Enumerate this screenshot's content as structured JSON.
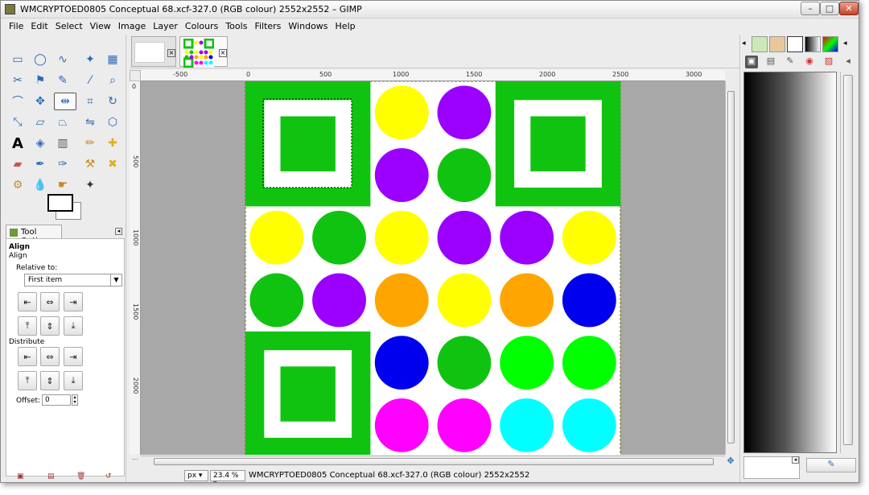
{
  "window": {
    "title": "WMCRYPTOED0805 Conceptual 68.xcf-327.0 (RGB colour) 2552x2552 – GIMP",
    "min_glyph": "–",
    "max_glyph": "□",
    "close_glyph": "✕"
  },
  "menubar": {
    "items": [
      "File",
      "Edit",
      "Select",
      "View",
      "Image",
      "Layer",
      "Colours",
      "Tools",
      "Filters",
      "Windows",
      "Help"
    ]
  },
  "toolbox": {
    "tool_options_tab": "Tool Options",
    "align_header": "Align",
    "align_sub": "Align",
    "relative_to_label": "Relative to:",
    "relative_to_value": "First item",
    "distribute_label": "Distribute",
    "offset_label": "Offset:",
    "offset_value": "0"
  },
  "ruler": {
    "h_labels": [
      "-500",
      "0",
      "500",
      "1000",
      "1500",
      "2000",
      "2500",
      "3000"
    ],
    "v_labels": [
      "0",
      "500",
      "1000",
      "1500",
      "2000"
    ]
  },
  "statusbar": {
    "unit": "px",
    "zoom": "23.4 %",
    "text": "WMCRYPTOED0805 Conceptual 68.xcf-327.0 (RGB colour) 2552x2552"
  },
  "colors": {
    "green": "#11c311",
    "yellow": "#ffff00",
    "purple": "#9b00ff",
    "orange": "#ffa500",
    "blue": "#0000ee",
    "lime": "#00ff00",
    "magenta": "#ff00ff",
    "cyan": "#00ffff",
    "white": "#ffffff"
  },
  "canvas": {
    "circles": [
      [
        "",
        "",
        "yellow",
        "purple",
        "",
        ""
      ],
      [
        "",
        "",
        "purple",
        "green",
        "",
        ""
      ],
      [
        "yellow",
        "green",
        "yellow",
        "purple",
        "purple",
        "yellow"
      ],
      [
        "green",
        "purple",
        "orange",
        "yellow",
        "orange",
        "blue"
      ],
      [
        "",
        "",
        "blue",
        "green",
        "lime",
        "lime"
      ],
      [
        "",
        "",
        "magenta",
        "magenta",
        "cyan",
        "cyan"
      ]
    ]
  }
}
